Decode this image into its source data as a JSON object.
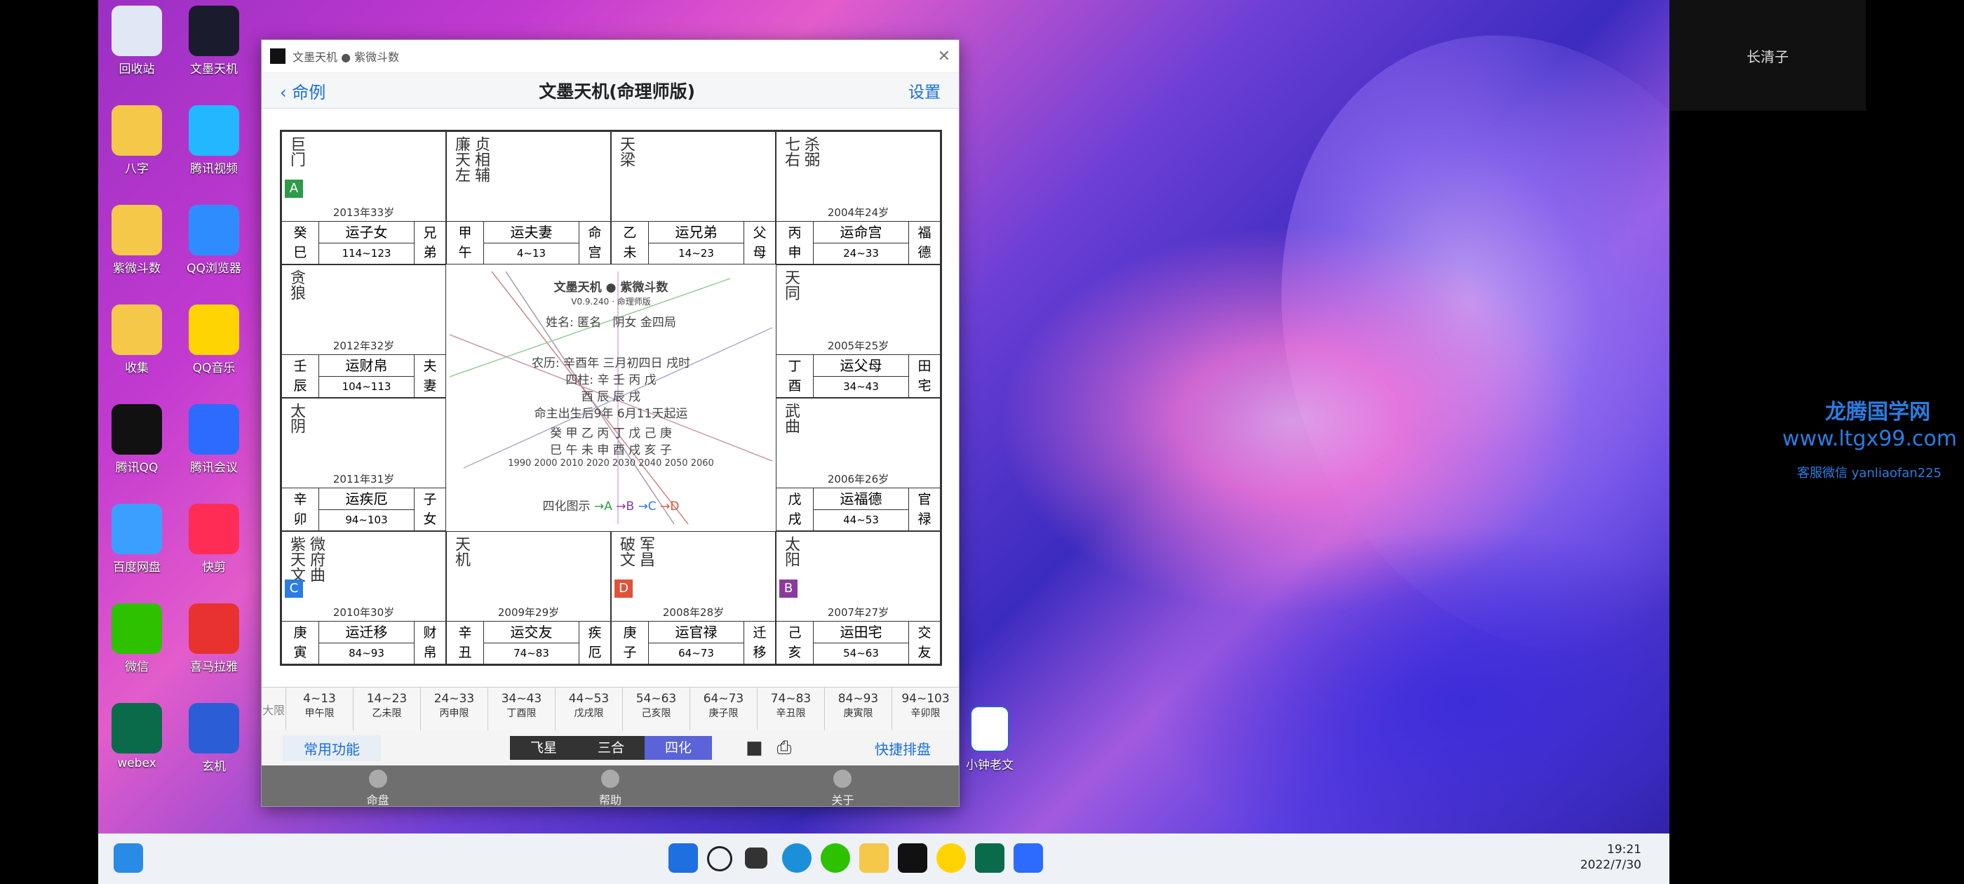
{
  "desktop": {
    "icons": [
      {
        "label": "回收站",
        "icon": "recycle-bin-icon",
        "color": "#dfe8f4"
      },
      {
        "label": "文墨天机",
        "icon": "app-icon",
        "color": "#1b1b2e"
      },
      {
        "label": "八字",
        "icon": "folder-icon",
        "color": "#f5c84a"
      },
      {
        "label": "腾讯视频",
        "icon": "video-icon",
        "color": "#22b7ff"
      },
      {
        "label": "紫微斗数",
        "icon": "folder-icon",
        "color": "#f5c84a"
      },
      {
        "label": "QQ浏览器",
        "icon": "browser-icon",
        "color": "#2f8cff"
      },
      {
        "label": "收集",
        "icon": "folder-icon",
        "color": "#f5c84a"
      },
      {
        "label": "QQ音乐",
        "icon": "music-icon",
        "color": "#ffd400"
      },
      {
        "label": "腾讯QQ",
        "icon": "qq-icon",
        "color": "#111111"
      },
      {
        "label": "腾讯会议",
        "icon": "meeting-icon",
        "color": "#2d6bff"
      },
      {
        "label": "百度网盘",
        "icon": "cloud-icon",
        "color": "#3aa0ff"
      },
      {
        "label": "快剪",
        "icon": "kuaijian-icon",
        "color": "#ff2d55"
      },
      {
        "label": "微信",
        "icon": "wechat-icon",
        "color": "#2dc100"
      },
      {
        "label": "喜马拉雅",
        "icon": "ximalaya-icon",
        "color": "#e8322f"
      },
      {
        "label": "webex",
        "icon": "webex-icon",
        "color": "#0a6b4a"
      },
      {
        "label": "玄机",
        "icon": "word-doc-icon",
        "color": "#2b5ed6"
      }
    ],
    "file_icon": {
      "label": "小钟老文",
      "icon": "word-doc-icon"
    }
  },
  "window": {
    "titlebar": "文墨天机 ● 紫微斗数",
    "back_label": "命例",
    "title": "文墨天机(命理师版)",
    "settings_label": "设置"
  },
  "palaces": [
    {
      "stars": "巨门",
      "badge": "A",
      "badge_color": "#2e9b4a",
      "year": "2013年33岁",
      "gan": "癸",
      "zhi": "巳",
      "yun": "运子女",
      "age": "114~123",
      "pal1": "兄",
      "pal2": "弟"
    },
    {
      "stars": "廉天左",
      "stars2": "贞相辅",
      "badge": "",
      "year": "",
      "gan": "甲",
      "zhi": "午",
      "yun": "运夫妻",
      "age": "4~13",
      "pal1": "命",
      "pal2": "宫"
    },
    {
      "stars": "天梁",
      "badge": "",
      "year": "",
      "gan": "乙",
      "zhi": "未",
      "yun": "运兄弟",
      "age": "14~23",
      "pal1": "父",
      "pal2": "母"
    },
    {
      "stars": "七右",
      "stars2": "杀弼",
      "badge": "",
      "year": "2004年24岁",
      "gan": "丙",
      "zhi": "申",
      "yun": "运命宫",
      "age": "24~33",
      "pal1": "福",
      "pal2": "德"
    },
    {
      "stars": "贪狼",
      "badge": "",
      "year": "2012年32岁",
      "gan": "壬",
      "zhi": "辰",
      "yun": "运财帛",
      "age": "104~113",
      "pal1": "夫",
      "pal2": "妻"
    },
    {
      "stars": "天同",
      "badge": "",
      "year": "2005年25岁",
      "gan": "丁",
      "zhi": "酉",
      "yun": "运父母",
      "age": "34~43",
      "pal1": "田",
      "pal2": "宅"
    },
    {
      "stars": "太阴",
      "badge": "",
      "year": "2011年31岁",
      "gan": "辛",
      "zhi": "卯",
      "yun": "运疾厄",
      "age": "94~103",
      "pal1": "子",
      "pal2": "女"
    },
    {
      "stars": "武曲",
      "badge": "",
      "year": "2006年26岁",
      "gan": "戊",
      "zhi": "戌",
      "yun": "运福德",
      "age": "44~53",
      "pal1": "官",
      "pal2": "禄"
    },
    {
      "stars": "紫天文",
      "stars2": "微府曲",
      "badge": "C",
      "badge_color": "#2a7de0",
      "year": "2010年30岁",
      "gan": "庚",
      "zhi": "寅",
      "yun": "运迁移",
      "age": "84~93",
      "pal1": "财",
      "pal2": "帛"
    },
    {
      "stars": "天机",
      "badge": "",
      "year": "2009年29岁",
      "gan": "辛",
      "zhi": "丑",
      "yun": "运交友",
      "age": "74~83",
      "pal1": "疾",
      "pal2": "厄"
    },
    {
      "stars": "破文",
      "stars2": "军昌",
      "badge": "D",
      "badge_color": "#e0523a",
      "year": "2008年28岁",
      "gan": "庚",
      "zhi": "子",
      "yun": "运官禄",
      "age": "64~73",
      "pal1": "迁",
      "pal2": "移"
    },
    {
      "stars": "太阳",
      "badge": "B",
      "badge_color": "#8b3a9c",
      "year": "2007年27岁",
      "gan": "己",
      "zhi": "亥",
      "yun": "运田宅",
      "age": "54~63",
      "pal1": "交",
      "pal2": "友"
    }
  ],
  "center": {
    "brand": "文墨天机 ● 紫微斗数",
    "version": "V0.9.240 · 命理师版",
    "name": "姓名: 匿名",
    "gender": "阴女 金四局",
    "lunar": "农历: 辛酉年 三月初四日 戌时",
    "sizhu": "四柱: 辛  壬  丙  戊",
    "sizhu2": "酉  辰  辰  戌",
    "qiyun": "命主出生后9年 6月11天起运",
    "dayun_gan": "癸  甲  乙  丙  丁  戊  己  庚",
    "dayun_zhi": "巳  午  未  申  酉  戌  亥  子",
    "dayun_years": "1990 2000 2010 2020 2030 2040 2050 2060",
    "legend_label": "四化图示",
    "legend_a": "→A",
    "legend_b": "→B",
    "legend_c": "→C",
    "legend_d": "→D"
  },
  "daxian": {
    "label": "大限",
    "items": [
      {
        "range": "4~13",
        "name": "甲午限"
      },
      {
        "range": "14~23",
        "name": "乙未限"
      },
      {
        "range": "24~33",
        "name": "丙申限"
      },
      {
        "range": "34~43",
        "name": "丁酉限"
      },
      {
        "range": "44~53",
        "name": "戊戌限"
      },
      {
        "range": "54~63",
        "name": "己亥限"
      },
      {
        "range": "64~73",
        "name": "庚子限"
      },
      {
        "range": "74~83",
        "name": "辛丑限"
      },
      {
        "range": "84~93",
        "name": "庚寅限"
      },
      {
        "range": "94~103",
        "name": "辛卯限"
      }
    ]
  },
  "toolbar": {
    "common": "常用功能",
    "seg": [
      "飞星",
      "三合",
      "四化"
    ],
    "quick": "快捷排盘"
  },
  "tabs": [
    "命盘",
    "帮助",
    "关于"
  ],
  "taskbar": {
    "time": "19:21",
    "date": "2022/7/30"
  },
  "right": {
    "username": "长清子",
    "watermark1": "龙腾国学网",
    "watermark2": "www.ltgx99.com",
    "watermark3": "客服微信 yanliaofan225"
  }
}
